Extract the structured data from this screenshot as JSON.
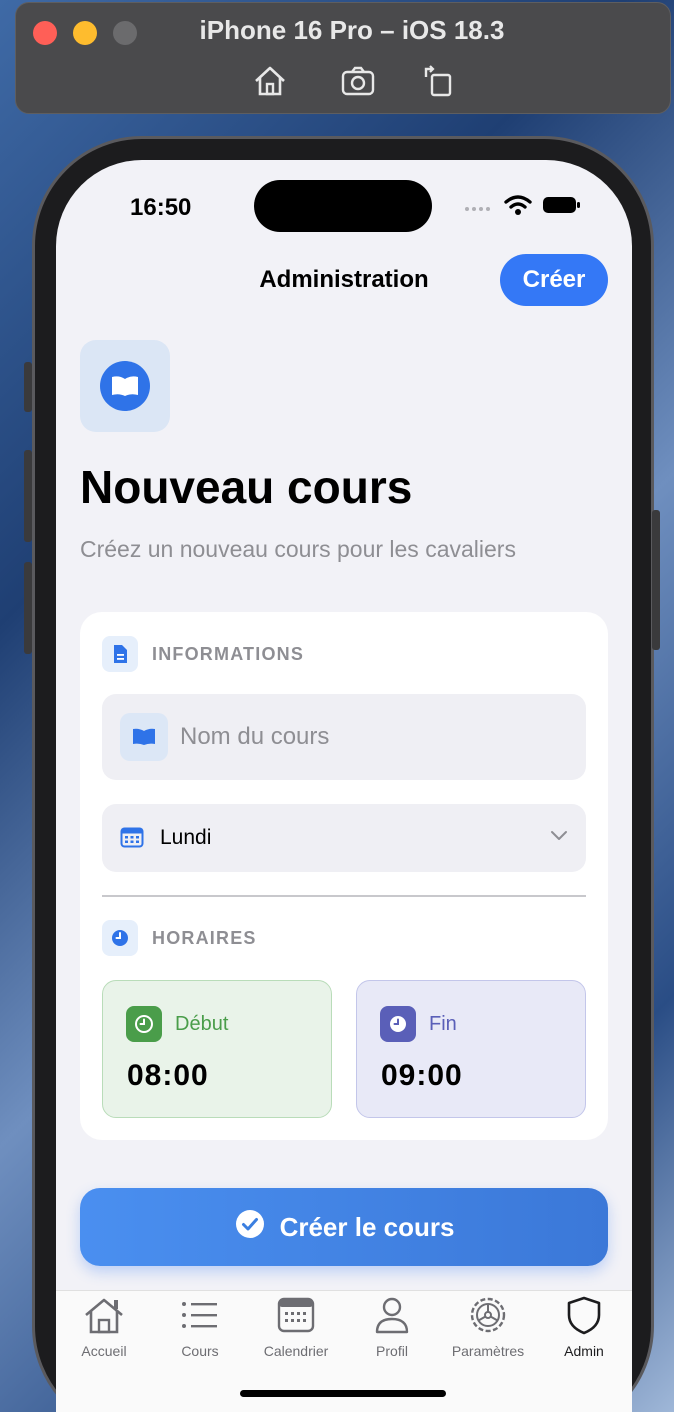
{
  "simulator": {
    "title": "iPhone 16 Pro – iOS 18.3",
    "toolbar_icons": [
      "home-icon",
      "screenshot-icon",
      "rotate-icon"
    ]
  },
  "status_bar": {
    "time": "16:50"
  },
  "nav": {
    "title": "Administration",
    "create_label": "Créer"
  },
  "hero": {
    "icon": "book-icon",
    "title": "Nouveau cours",
    "subtitle": "Créez un nouveau cours pour les cavaliers"
  },
  "form": {
    "informations_label": "INFORMATIONS",
    "name_placeholder": "Nom du cours",
    "name_value": "",
    "day_value": "Lundi",
    "horaires_label": "HORAIRES",
    "start": {
      "label": "Début",
      "value": "08:00",
      "color": "#4a9d4a"
    },
    "end": {
      "label": "Fin",
      "value": "09:00",
      "color": "#5a5fb8"
    }
  },
  "submit_label": "Créer le cours",
  "tabs": [
    {
      "label": "Accueil",
      "icon": "home-icon",
      "active": false
    },
    {
      "label": "Cours",
      "icon": "list-icon",
      "active": false
    },
    {
      "label": "Calendrier",
      "icon": "calendar-icon",
      "active": false
    },
    {
      "label": "Profil",
      "icon": "person-icon",
      "active": false
    },
    {
      "label": "Paramètres",
      "icon": "gear-icon",
      "active": false
    },
    {
      "label": "Admin",
      "icon": "shield-icon",
      "active": true
    }
  ],
  "colors": {
    "accent": "#3478f6",
    "background": "#f2f2f7"
  }
}
